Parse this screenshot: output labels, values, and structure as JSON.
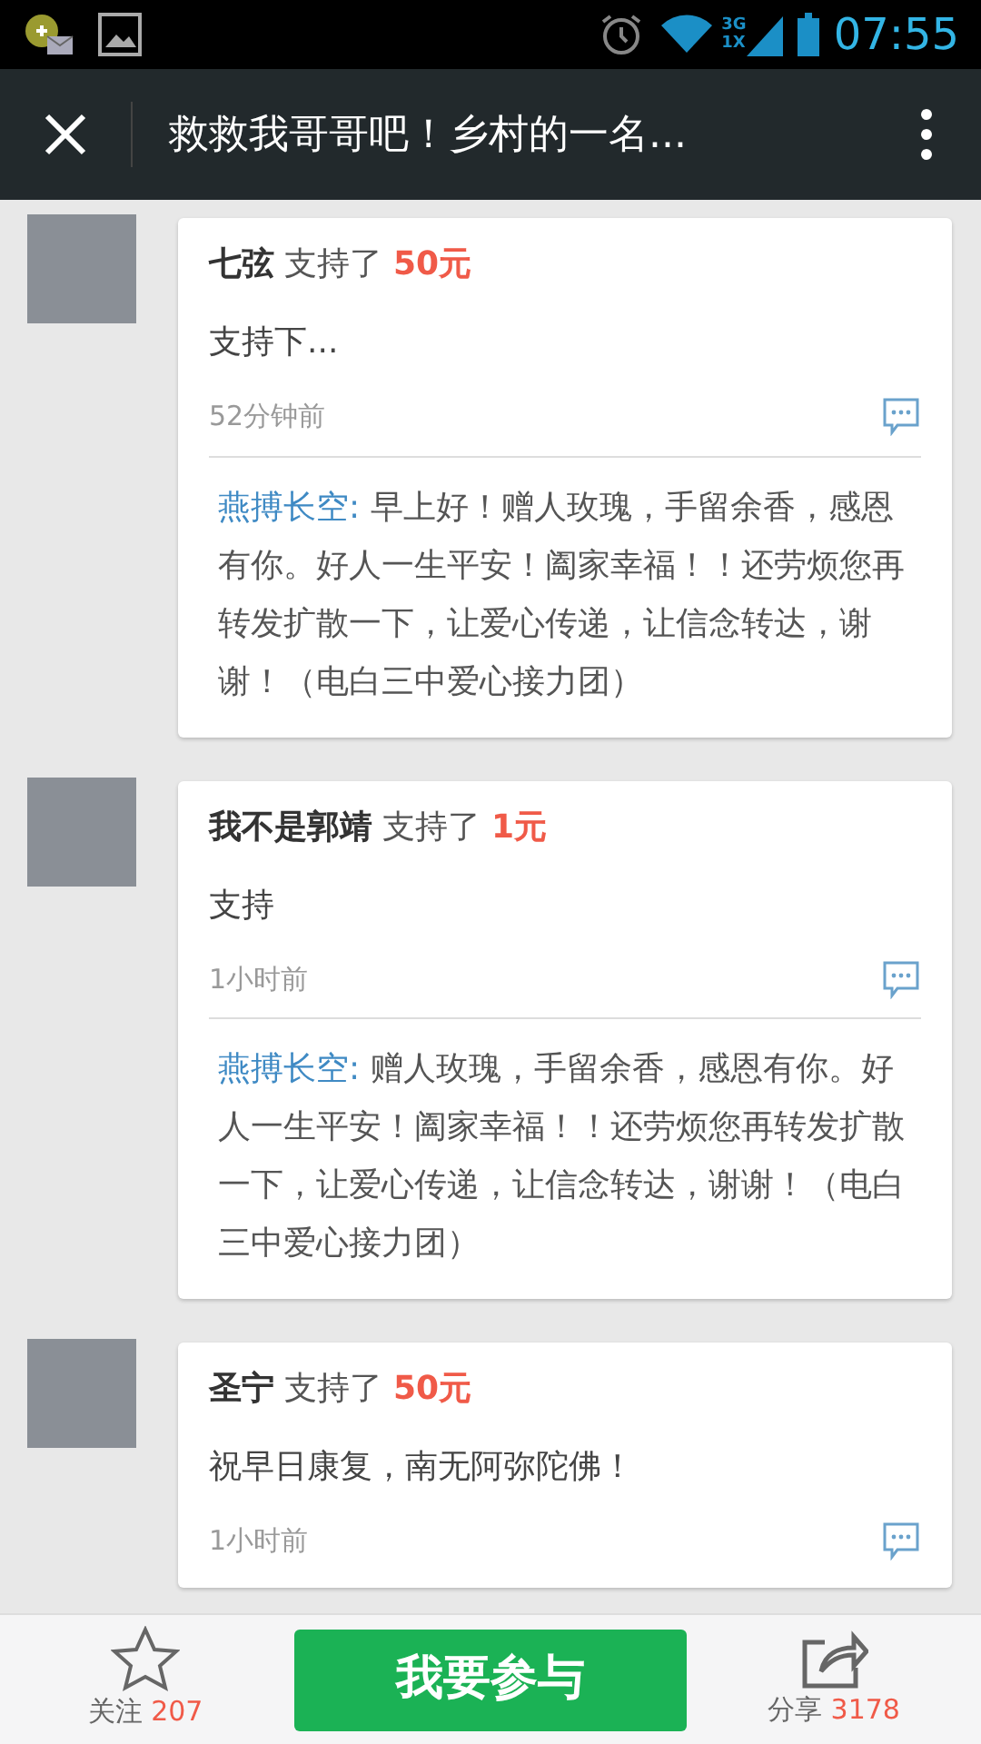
{
  "status_bar": {
    "time": "07:55",
    "network": "3G",
    "network_2": "1X"
  },
  "header": {
    "title": "救救我哥哥吧！乡村的一名..."
  },
  "comments": [
    {
      "name": "七弦",
      "action": "支持了",
      "amount": "50元",
      "text": "支持下...",
      "time": "52分钟前",
      "reply": {
        "name": "燕搏长空:",
        "text": "早上好！赠人玫瑰，手留余香，感恩有你。好人一生平安！阖家幸福！！还劳烦您再转发扩散一下，让爱心传递，让信念转达，谢谢！（电白三中爱心接力团）"
      }
    },
    {
      "name": "我不是郭靖",
      "action": "支持了",
      "amount": "1元",
      "text": "支持",
      "time": "1小时前",
      "reply": {
        "name": "燕搏长空:",
        "text": "赠人玫瑰，手留余香，感恩有你。好人一生平安！阖家幸福！！还劳烦您再转发扩散一下，让爱心传递，让信念转达，谢谢！（电白三中爱心接力团）"
      }
    },
    {
      "name": "圣宁",
      "action": "支持了",
      "amount": "50元",
      "text": "祝早日康复，南无阿弥陀佛！",
      "time": "1小时前"
    }
  ],
  "bottom_bar": {
    "follow_label": "关注",
    "follow_count": "207",
    "join_button": "我要参与",
    "share_label": "分享",
    "share_count": "3178"
  }
}
